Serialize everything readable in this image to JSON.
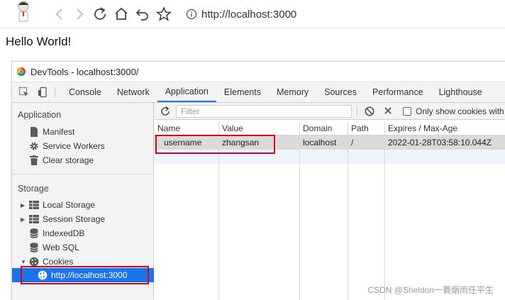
{
  "browser": {
    "url": "http://localhost:3000"
  },
  "page": {
    "text": "Hello World!"
  },
  "devtools": {
    "title": "DevTools - localhost:3000/",
    "tabs": [
      "Console",
      "Network",
      "Application",
      "Elements",
      "Memory",
      "Sources",
      "Performance",
      "Lighthouse"
    ],
    "active_tab": "Application",
    "sidebar": {
      "application_header": "Application",
      "application_items": [
        "Manifest",
        "Service Workers",
        "Clear storage"
      ],
      "storage_header": "Storage",
      "storage_items": [
        "Local Storage",
        "Session Storage",
        "IndexedDB",
        "Web SQL",
        "Cookies"
      ],
      "cookie_origin": "http://localhost:3000"
    },
    "filter": {
      "placeholder": "Filter",
      "only_show_label": "Only show cookies with"
    },
    "table": {
      "headers": [
        "Name",
        "Value",
        "Domain",
        "Path",
        "Expires / Max-Age"
      ],
      "rows": [
        [
          "username",
          "zhangsan",
          "localhost",
          "/",
          "2022-01-28T03:58:10.044Z"
        ]
      ]
    }
  },
  "watermark": "CSDN @Sheldon一蓑烟雨任平生",
  "colors": {
    "accent": "#1a73e8",
    "highlight": "#e0001a"
  }
}
